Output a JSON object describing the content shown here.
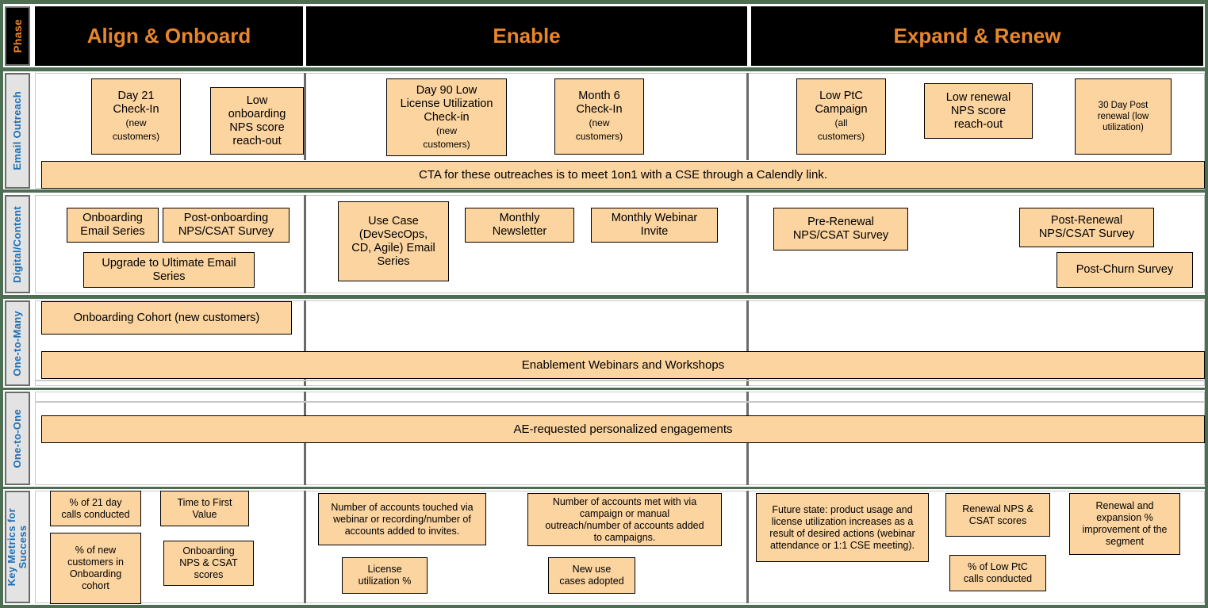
{
  "meta": {
    "accent_orange": "#e8862b",
    "box_fill": "#fbd4a0",
    "frame_green": "#4e6e53",
    "rail_label_blue": "#1f6fb5"
  },
  "phase_row": {
    "rail_label": "Phase",
    "columns": [
      {
        "label": "Align & Onboard"
      },
      {
        "label": "Enable"
      },
      {
        "label": "Expand & Renew"
      }
    ]
  },
  "rows": [
    {
      "id": "email-outreach",
      "rail_label": "Email Outreach",
      "boxes": [
        {
          "id": "day-21-check-in",
          "main": "Day 21\nCheck-In",
          "sub": "(new\ncustomers)"
        },
        {
          "id": "low-onboarding-nps",
          "main": "Low\nonboarding\nNPS score\nreach-out"
        },
        {
          "id": "day-90-license-util",
          "main": "Day 90 Low\nLicense Utilization\nCheck-in ",
          "sub": "(new\ncustomers)"
        },
        {
          "id": "month-6-check-in",
          "main": "Month 6\nCheck-In",
          "sub": "(new\ncustomers)"
        },
        {
          "id": "low-ptc-campaign",
          "main": "Low PtC\nCampaign",
          "sub": "(all\ncustomers)"
        },
        {
          "id": "low-renewal-nps",
          "main": "Low renewal\nNPS score\nreach-out"
        },
        {
          "id": "30-day-post-renewal",
          "main": "30 Day Post\nrenewal (low\nutilization)"
        }
      ],
      "banner": "CTA for these outreaches is to meet 1on1 with a CSE through a Calendly link."
    },
    {
      "id": "digital-content",
      "rail_label": "Digital/Content",
      "boxes": [
        {
          "id": "onboarding-email-series",
          "main": "Onboarding\nEmail Series"
        },
        {
          "id": "post-onboarding-survey",
          "main": "Post-onboarding\nNPS/CSAT Survey"
        },
        {
          "id": "upgrade-ultimate-email",
          "main": "Upgrade to Ultimate Email\nSeries"
        },
        {
          "id": "use-case-email-series",
          "main": "Use Case\n(DevSecOps,\nCD, Agile) Email\nSeries"
        },
        {
          "id": "monthly-newsletter",
          "main": "Monthly\nNewsletter"
        },
        {
          "id": "monthly-webinar-invite",
          "main": "Monthly Webinar\nInvite"
        },
        {
          "id": "pre-renewal-survey",
          "main": "Pre-Renewal\nNPS/CSAT Survey"
        },
        {
          "id": "post-renewal-survey",
          "main": "Post-Renewal\nNPS/CSAT Survey"
        },
        {
          "id": "post-churn-survey",
          "main": "Post-Churn Survey"
        }
      ]
    },
    {
      "id": "one-to-many",
      "rail_label": "One-to-Many",
      "boxes": [
        {
          "id": "onboarding-cohort",
          "main": "Onboarding Cohort (new customers)"
        }
      ],
      "banner": "Enablement Webinars and Workshops"
    },
    {
      "id": "one-to-one",
      "rail_label": "One-to-One",
      "boxes": [],
      "banner": "AE-requested personalized engagements"
    },
    {
      "id": "key-metrics",
      "rail_label": "Key Metrics for\nSuccess",
      "boxes": [
        {
          "id": "pct-21-day-calls",
          "main": "% of 21 day\ncalls conducted"
        },
        {
          "id": "time-to-first-value",
          "main": "Time to First\nValue"
        },
        {
          "id": "pct-new-customers-cohort",
          "main": "% of new\ncustomers in\nOnboarding\ncohort"
        },
        {
          "id": "onboarding-nps-csat",
          "main": "Onboarding\nNPS & CSAT\nscores"
        },
        {
          "id": "accounts-touched-webinar",
          "main": "Number of accounts touched via\nwebinar or recording/number of\naccounts added to invites."
        },
        {
          "id": "license-utilization-pct",
          "main": "License\nutilization %"
        },
        {
          "id": "accounts-met-campaign",
          "main": "Number of accounts met with via\ncampaign or manual\noutreach/number of accounts added\nto campaigns."
        },
        {
          "id": "new-use-cases-adopted",
          "main": "New use\ncases adopted"
        },
        {
          "id": "future-state-usage",
          "main": "Future state: product usage and\nlicense utilization increases as a\nresult of desired actions (webinar\nattendance or 1:1 CSE meeting)."
        },
        {
          "id": "renewal-nps-csat",
          "main": "Renewal NPS &\nCSAT scores"
        },
        {
          "id": "pct-low-ptc-calls",
          "main": "% of Low PtC\ncalls conducted"
        },
        {
          "id": "renewal-expansion-improvement",
          "main": "Renewal and\nexpansion %\nimprovement of the\nsegment"
        }
      ]
    }
  ]
}
